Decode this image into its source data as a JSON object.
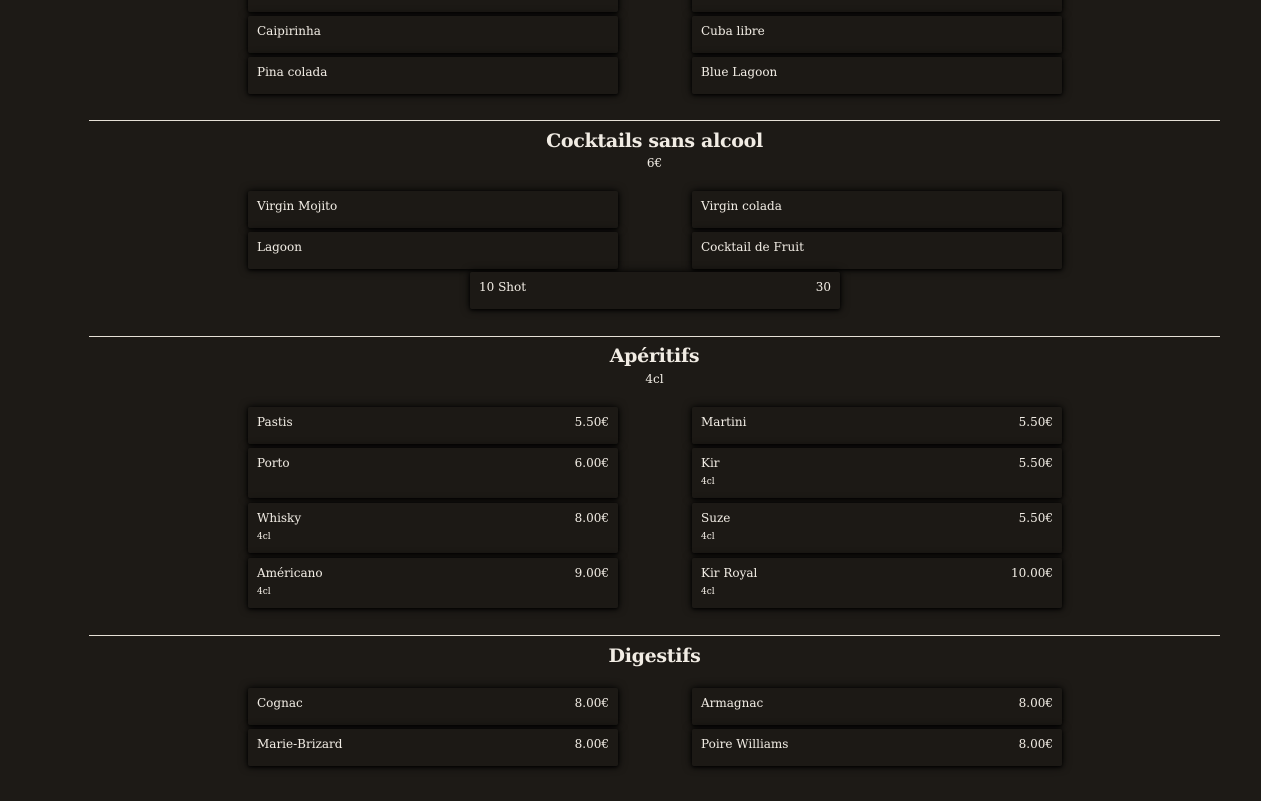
{
  "cocktails_avec_alcool": {
    "items": [
      {
        "name": "Caipirinha"
      },
      {
        "name": "Cuba libre"
      },
      {
        "name": "Pina colada"
      },
      {
        "name": "Blue Lagoon"
      }
    ]
  },
  "cocktails_sans_alcool": {
    "title": "Cocktails sans alcool",
    "subtitle": "6€",
    "items": [
      {
        "name": "Virgin Mojito"
      },
      {
        "name": "Virgin colada"
      },
      {
        "name": "Lagoon"
      },
      {
        "name": "Cocktail de Fruit"
      }
    ],
    "shot": {
      "name": "10 Shot",
      "price": "30"
    }
  },
  "aperitifs": {
    "title": "Apéritifs",
    "subtitle": "4cl",
    "items": [
      {
        "name": "Pastis",
        "price": "5.50€"
      },
      {
        "name": "Martini",
        "price": "5.50€"
      },
      {
        "name": "Porto",
        "price": "6.00€"
      },
      {
        "name": "Kir",
        "price": "5.50€",
        "size": "4cl"
      },
      {
        "name": "Whisky",
        "price": "8.00€",
        "size": "4cl"
      },
      {
        "name": "Suze",
        "price": "5.50€",
        "size": "4cl"
      },
      {
        "name": "Américano",
        "price": "9.00€",
        "size": "4cl"
      },
      {
        "name": "Kir Royal",
        "price": "10.00€",
        "size": "4cl"
      }
    ]
  },
  "digestifs": {
    "title": "Digestifs",
    "items": [
      {
        "name": "Cognac",
        "price": "8.00€"
      },
      {
        "name": "Armagnac",
        "price": "8.00€"
      },
      {
        "name": "Marie-Brizard",
        "price": "8.00€"
      },
      {
        "name": "Poire Williams",
        "price": "8.00€"
      }
    ]
  }
}
